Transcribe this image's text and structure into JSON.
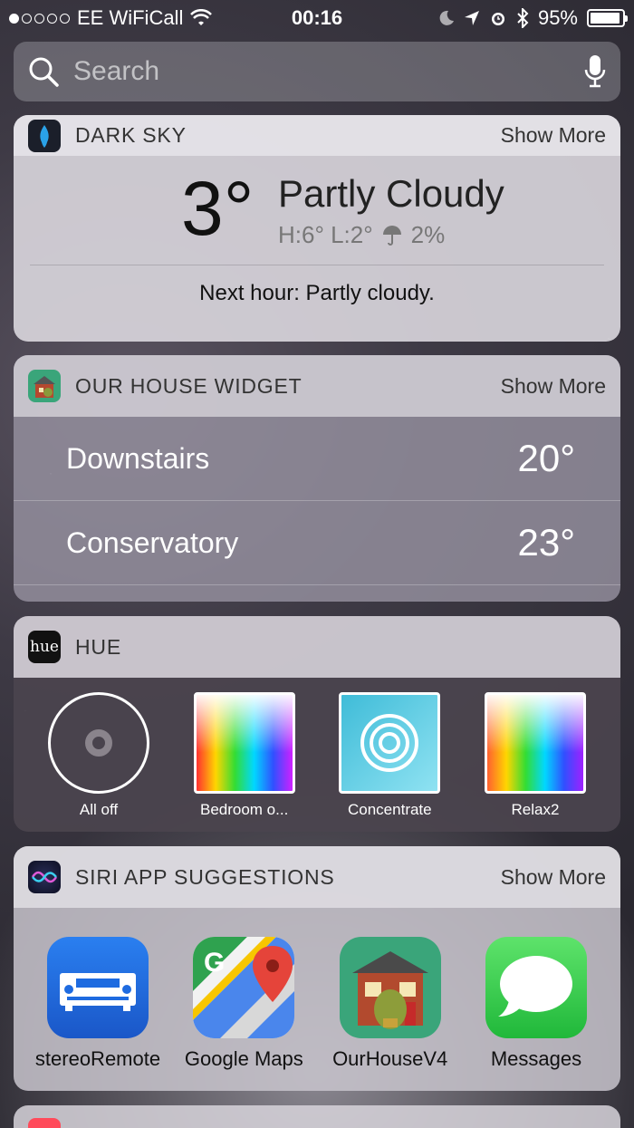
{
  "status_bar": {
    "carrier": "EE WiFiCall",
    "time": "00:16",
    "battery_percent": "95%",
    "battery_level": 0.95
  },
  "search": {
    "placeholder": "Search"
  },
  "dark_sky": {
    "title": "DARK SKY",
    "show_more": "Show More",
    "temperature": "3°",
    "condition": "Partly Cloudy",
    "high_low": "H:6° L:2°",
    "precip": "2%",
    "next_hour": "Next hour: Partly cloudy."
  },
  "our_house": {
    "title": "OUR HOUSE WIDGET",
    "show_more": "Show More",
    "rooms": [
      {
        "name": "Downstairs",
        "temp": "20°"
      },
      {
        "name": "Conservatory",
        "temp": "23°"
      }
    ]
  },
  "hue": {
    "title": "HUE",
    "icon_text": "hue",
    "items": [
      {
        "label": "All off"
      },
      {
        "label": "Bedroom o..."
      },
      {
        "label": "Concentrate"
      },
      {
        "label": "Relax2"
      }
    ]
  },
  "siri": {
    "title": "SIRI APP SUGGESTIONS",
    "show_more": "Show More",
    "apps": [
      {
        "label": "stereoRemote",
        "icon": "stereo-receiver-icon"
      },
      {
        "label": "Google Maps",
        "icon": "google-maps-icon"
      },
      {
        "label": "OurHouseV4",
        "icon": "house-icon"
      },
      {
        "label": "Messages",
        "icon": "messages-icon"
      }
    ]
  },
  "colors": {
    "accent_white": "#ffffff",
    "hue_bg": "#4b444e",
    "messages_green": "#34c749",
    "stereo_blue": "#1e6be0"
  }
}
